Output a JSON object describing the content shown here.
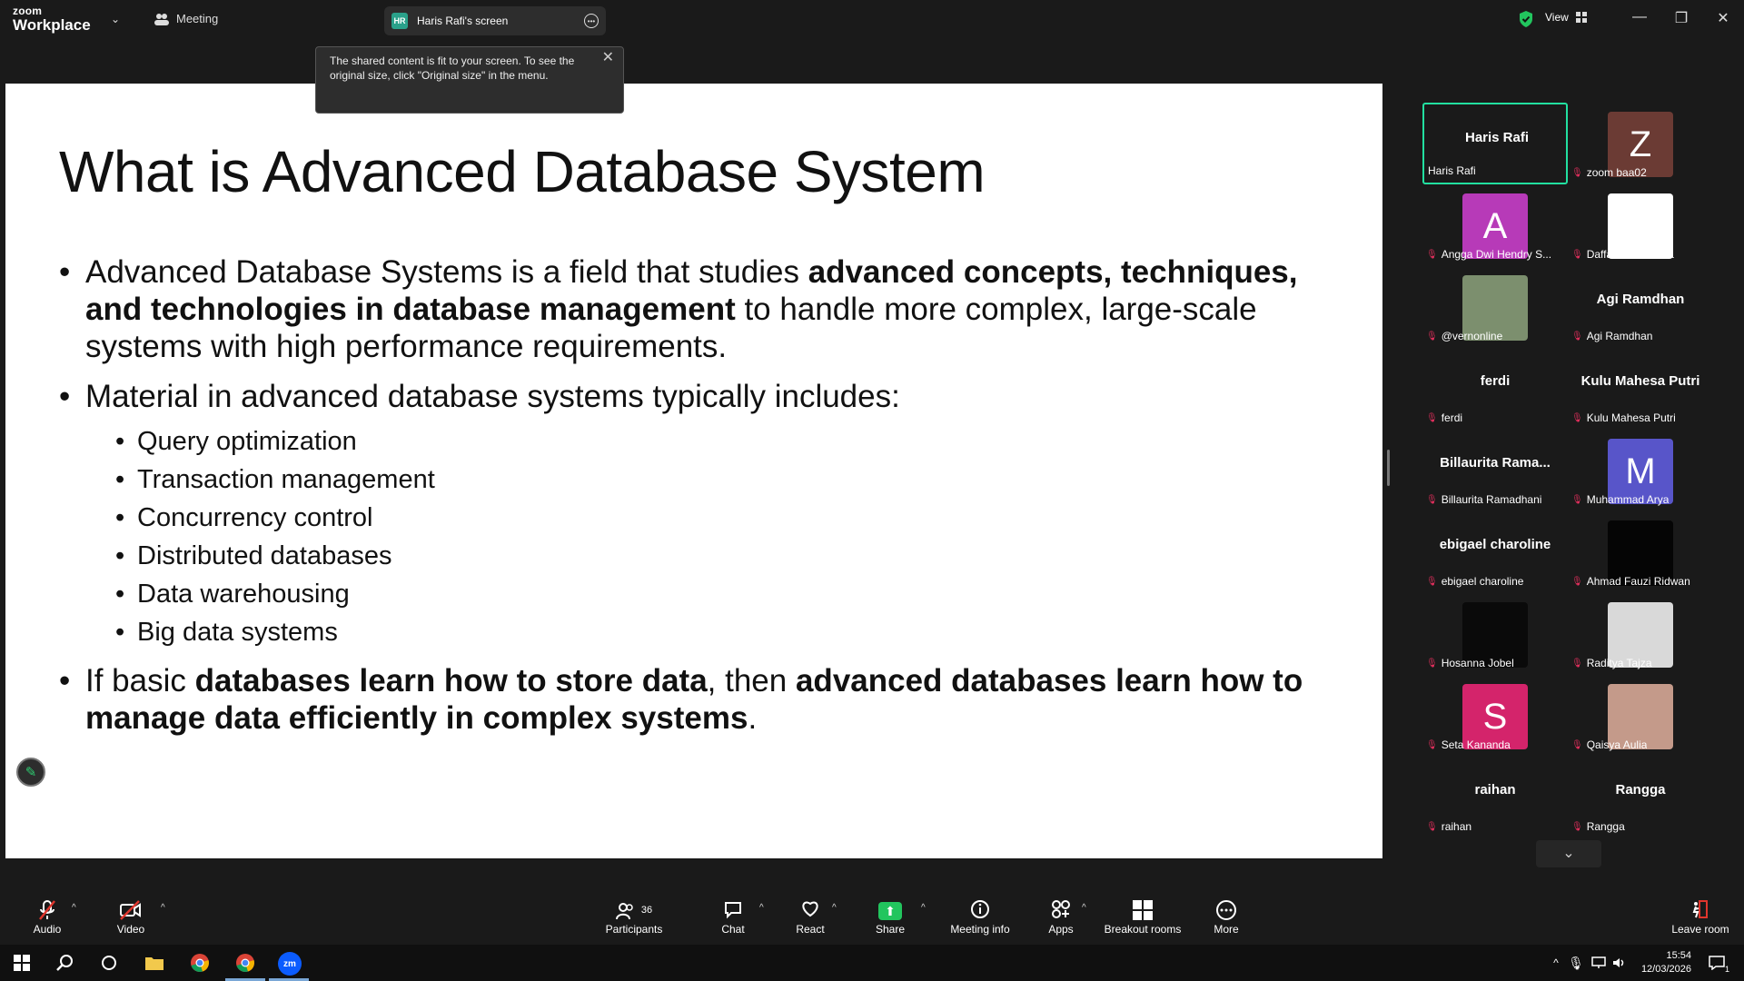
{
  "topbar": {
    "logo_small": "zoom",
    "logo_big": "Workplace",
    "meeting_label": "Meeting",
    "screen_tab_initials": "HR",
    "screen_tab_label": "Haris Rafi's screen",
    "view_label": "View"
  },
  "tooltip": {
    "text": "The shared content is fit to your screen. To see the original size, click \"Original size\" in the menu."
  },
  "slide": {
    "title": "What is Advanced Database System",
    "b1_pre": "Advanced Database Systems is a field that studies ",
    "b1_bold": "advanced concepts, techniques, and technologies in database management",
    "b1_post": " to handle more complex, large-scale systems with high performance requirements.",
    "b2": "Material in advanced database systems typically includes:",
    "subitems": [
      "Query optimization",
      "Transaction management",
      "Concurrency control",
      "Distributed databases",
      "Data warehousing",
      "Big data systems"
    ],
    "b3_pre": "If basic ",
    "b3_bold1": "databases learn how to store data",
    "b3_mid": ", then ",
    "b3_bold2": "advanced databases learn how to manage data efficiently in complex systems",
    "b3_post": "."
  },
  "participants": [
    {
      "big": "Haris Rafi",
      "label": "Haris Rafi",
      "muted": false
    },
    {
      "avatar_letter": "Z",
      "avatar_color": "#6b3b34",
      "label": "zoom baa02",
      "muted": true
    },
    {
      "avatar_letter": "A",
      "avatar_color": "#b73ab8",
      "label": "Angga Dwi Hendry S...",
      "muted": true
    },
    {
      "avatar_color": "#ffffff",
      "label": "Daffa Gusti Yanza",
      "muted": true
    },
    {
      "avatar_color": "#7c8f6e",
      "label": "@vernonline",
      "muted": true
    },
    {
      "big": "Agi Ramdhan",
      "label": "Agi Ramdhan",
      "muted": true
    },
    {
      "big": "ferdi",
      "label": "ferdi",
      "muted": true
    },
    {
      "big": "Kulu Mahesa Putri",
      "label": "Kulu Mahesa Putri",
      "muted": true
    },
    {
      "big": "Billaurita  Rama...",
      "label": "Billaurita Ramadhani",
      "muted": true
    },
    {
      "avatar_letter": "M",
      "avatar_color": "#5855c9",
      "label": "Muhammad Arya",
      "muted": true
    },
    {
      "big": "ebigael charoline",
      "label": "ebigael charoline",
      "muted": true
    },
    {
      "avatar_color": "#050505",
      "label": "Ahmad Fauzi Ridwan",
      "muted": true
    },
    {
      "avatar_color": "#0a0a0a",
      "label": "Hosanna Jobel",
      "muted": true
    },
    {
      "avatar_color": "#d9d9d9",
      "label": "Raditya Tajza",
      "muted": true
    },
    {
      "avatar_letter": "S",
      "avatar_color": "#d4246b",
      "label": "Seta Kananda",
      "muted": true
    },
    {
      "avatar_color": "#c49a8a",
      "label": "Qaisya Aulia",
      "muted": true
    },
    {
      "big": "raihan",
      "label": "raihan",
      "muted": true
    },
    {
      "big": "Rangga",
      "label": "Rangga",
      "muted": true
    }
  ],
  "toolbar": {
    "audio": "Audio",
    "video": "Video",
    "participants": "Participants",
    "participants_count": "36",
    "chat": "Chat",
    "react": "React",
    "share": "Share",
    "meeting_info": "Meeting info",
    "apps": "Apps",
    "breakout": "Breakout rooms",
    "more": "More",
    "leave": "Leave room"
  },
  "taskbar": {
    "time": "15:54",
    "date": "12/03/2026",
    "notification_count": "1",
    "zoom_app_label": "zm"
  }
}
